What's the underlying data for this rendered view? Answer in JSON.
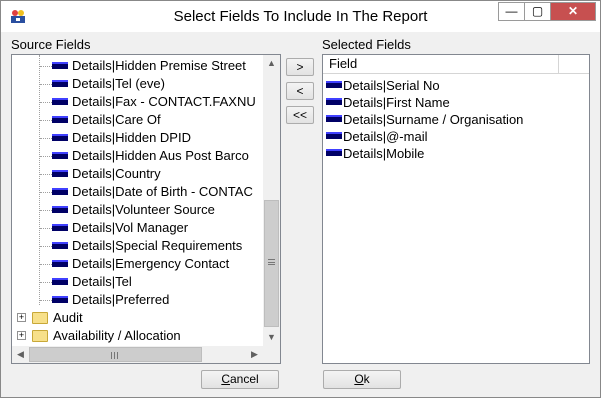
{
  "window": {
    "title": "Select Fields To Include In The Report",
    "controls": {
      "minimize": "—",
      "maximize": "▢",
      "close": "✕"
    }
  },
  "source": {
    "label": "Source Fields",
    "fields": [
      "Details|Hidden Premise Street",
      "Details|Tel (eve)",
      "Details|Fax - CONTACT.FAXNU",
      "Details|Care Of",
      "Details|Hidden DPID",
      "Details|Hidden Aus Post Barco",
      "Details|Country",
      "Details|Date of Birth - CONTAC",
      "Details|Volunteer Source",
      "Details|Vol Manager",
      "Details|Special Requirements",
      "Details|Emergency Contact",
      "Details|Tel",
      "Details|Preferred"
    ],
    "folders": [
      "Audit",
      "Availability / Allocation"
    ],
    "expander_symbol": "+"
  },
  "move_buttons": {
    "add": ">",
    "remove": "<",
    "remove_all": "<<"
  },
  "selected": {
    "label": "Selected Fields",
    "column_header": "Field",
    "fields": [
      "Details|Serial No",
      "Details|First Name",
      "Details|Surname / Organisation",
      "Details|@-mail",
      "Details|Mobile"
    ]
  },
  "buttons": {
    "cancel_mnemonic": "C",
    "cancel_rest": "ancel",
    "ok_mnemonic": "O",
    "ok_rest": "k"
  },
  "scroll_glyphs": {
    "up": "▲",
    "down": "▼",
    "left": "◀",
    "right": "▶"
  },
  "colors": {
    "field_icon": "#000066",
    "folder": "#f7e08a",
    "close_button": "#c75050"
  }
}
